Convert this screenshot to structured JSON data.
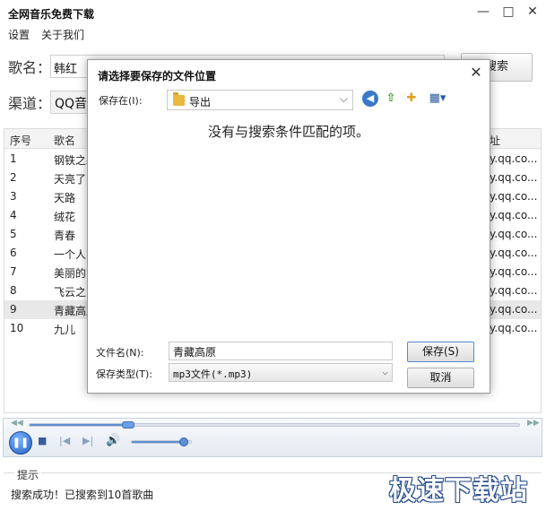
{
  "app": {
    "title": "全网音乐免费下载",
    "minimize": "—",
    "maximize": "□",
    "close": "✕"
  },
  "menu": [
    {
      "label": "设置"
    },
    {
      "label": "关于我们"
    }
  ],
  "search": {
    "song_label": "歌名：",
    "song_value": "韩红",
    "button_label": "搜索",
    "channel_label": "渠道：",
    "channel_value": "QQ音乐"
  },
  "table": {
    "columns": [
      "序号",
      "歌名",
      "址"
    ],
    "rows": [
      {
        "no": "1",
        "name": "钢铁之躯",
        "url": "y.qq.co..."
      },
      {
        "no": "2",
        "name": "天亮了",
        "url": "y.qq.co..."
      },
      {
        "no": "3",
        "name": "天路",
        "url": "y.qq.co..."
      },
      {
        "no": "4",
        "name": "绒花",
        "url": "y.qq.co..."
      },
      {
        "no": "5",
        "name": "青春",
        "url": "y.qq.co..."
      },
      {
        "no": "6",
        "name": "一个人",
        "url": "y.qq.co..."
      },
      {
        "no": "7",
        "name": "美丽的",
        "url": "y.qq.co..."
      },
      {
        "no": "8",
        "name": "飞云之",
        "url": "y.qq.co..."
      },
      {
        "no": "9",
        "name": "青藏高原",
        "url": "y.qq.co..."
      },
      {
        "no": "10",
        "name": "九儿",
        "url": "y.qq.co..."
      }
    ],
    "selected_row": 9
  },
  "player": {
    "seek_progress": 0.2,
    "volume": 0.85,
    "pause_icon": "pause-icon",
    "stop_icon": "stop-icon",
    "prev_icon": "previous-icon",
    "next_icon": "next-icon",
    "volume_icon": "speaker-icon"
  },
  "status": {
    "group_title": "提示",
    "message": "搜索成功！已搜索到10首歌曲"
  },
  "watermark": "极速下载站",
  "dialog": {
    "title": "请选择要保存的文件位置",
    "close": "✕",
    "save_in_label": "保存在(I):",
    "folder": "导出",
    "empty_message": "没有与搜索条件匹配的项。",
    "filename_label": "文件名(N):",
    "filename_value": "青藏高原",
    "filetype_label": "保存类型(T):",
    "filetype_value": "mp3文件(*.mp3)",
    "save_button": "保存(S)",
    "cancel_button": "取消"
  },
  "colors": {
    "accent": "#2a5fb0",
    "selected_row": "#e8e8e8"
  }
}
